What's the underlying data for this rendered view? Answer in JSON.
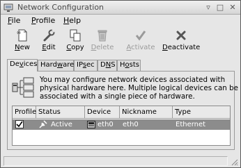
{
  "window": {
    "title": "Network Configuration"
  },
  "window_buttons": {
    "minimize": "▿",
    "maximize": "□",
    "close": "✕"
  },
  "menubar": [
    {
      "pre": "",
      "key": "F",
      "post": "ile"
    },
    {
      "pre": "",
      "key": "P",
      "post": "rofile"
    },
    {
      "pre": "",
      "key": "H",
      "post": "elp"
    }
  ],
  "toolbar": [
    {
      "pre": "",
      "key": "N",
      "post": "ew",
      "icon": "new-icon",
      "enabled": true
    },
    {
      "pre": "",
      "key": "E",
      "post": "dit",
      "icon": "wrench-icon",
      "enabled": true
    },
    {
      "pre": "",
      "key": "C",
      "post": "opy",
      "icon": "copy-icon",
      "enabled": true
    },
    {
      "pre": "",
      "key": "D",
      "post": "elete",
      "icon": "trash-icon",
      "enabled": false
    },
    {
      "pre": "",
      "key": "A",
      "post": "ctivate",
      "icon": "check-icon",
      "enabled": false
    },
    {
      "pre": "",
      "key": "D",
      "post": "eactivate",
      "icon": "x-icon",
      "enabled": true
    }
  ],
  "tabs": [
    {
      "pre": "De",
      "key": "v",
      "post": "ices",
      "active": true
    },
    {
      "pre": "Hard",
      "key": "w",
      "post": "are",
      "active": false
    },
    {
      "pre": "IP",
      "key": "s",
      "post": "ec",
      "active": false
    },
    {
      "pre": "D",
      "key": "N",
      "post": "S",
      "active": false
    },
    {
      "pre": "H",
      "key": "o",
      "post": "sts",
      "active": false
    }
  ],
  "devices": {
    "description_lines": [
      "You may configure network devices associated with",
      "physical hardware here.  Multiple logical devices can be",
      "associated with a single piece of hardware."
    ],
    "columns": [
      "Profile",
      "Status",
      "Device",
      "Nickname",
      "Type"
    ],
    "rows": [
      {
        "profile_checked": true,
        "status": "Active",
        "device": "eth0",
        "nickname": "eth0",
        "type": "Ethernet"
      }
    ]
  },
  "colors": {
    "selection": "#8c8c8c",
    "window_bg": "#e6e6e6"
  }
}
